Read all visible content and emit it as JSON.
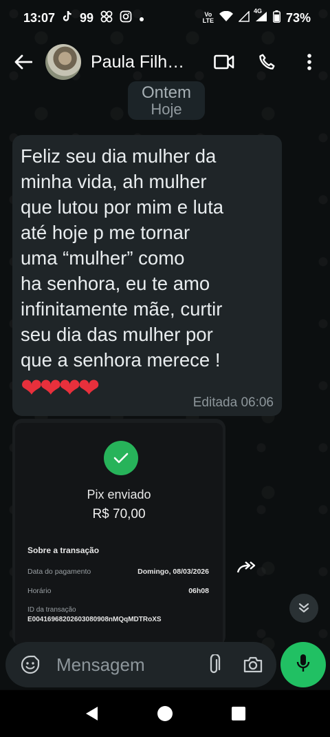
{
  "status_bar": {
    "time": "13:07",
    "notif_count": "99",
    "network_top": "Vo",
    "network_bottom": "LTE",
    "signal_label": "4G",
    "battery": "73%"
  },
  "header": {
    "contact_name": "Paula Filh…",
    "icons": [
      "back-arrow-icon",
      "video-call-icon",
      "phone-icon",
      "more-vert-icon"
    ]
  },
  "date_chip": {
    "behind": "Ontem",
    "front": "Hoje"
  },
  "message": {
    "text": "Feliz seu dia mulher da\nminha vida, ah mulher\nque lutou por mim e luta\naté hoje p me tornar\numa “mulher” como\nha senhora, eu te amo\ninfinitamente mãe, curtir\nseu dia das mulher por\nque a senhora merece !",
    "hearts": "❤❤❤❤",
    "meta": "Editada 06:06"
  },
  "receipt": {
    "title": "Pix enviado",
    "amount": "R$ 70,00",
    "section_title": "Sobre a transação",
    "rows": [
      {
        "label": "Data do pagamento",
        "value": "Domingo, 08/03/2026"
      },
      {
        "label": "Horário",
        "value": "06h08"
      }
    ],
    "id_label": "ID da transação",
    "id_value": "E00416968202603080908nMQqMDTRoXS",
    "accent_color": "#27b35a"
  },
  "composer": {
    "placeholder": "Mensagem",
    "icons": [
      "emoji-sticker-icon",
      "attach-icon",
      "camera-icon",
      "mic-icon"
    ]
  },
  "colors": {
    "background": "#0b0d0e",
    "bubble": "#1f2528",
    "mic_button": "#21c063",
    "heart": "#e8303c"
  }
}
